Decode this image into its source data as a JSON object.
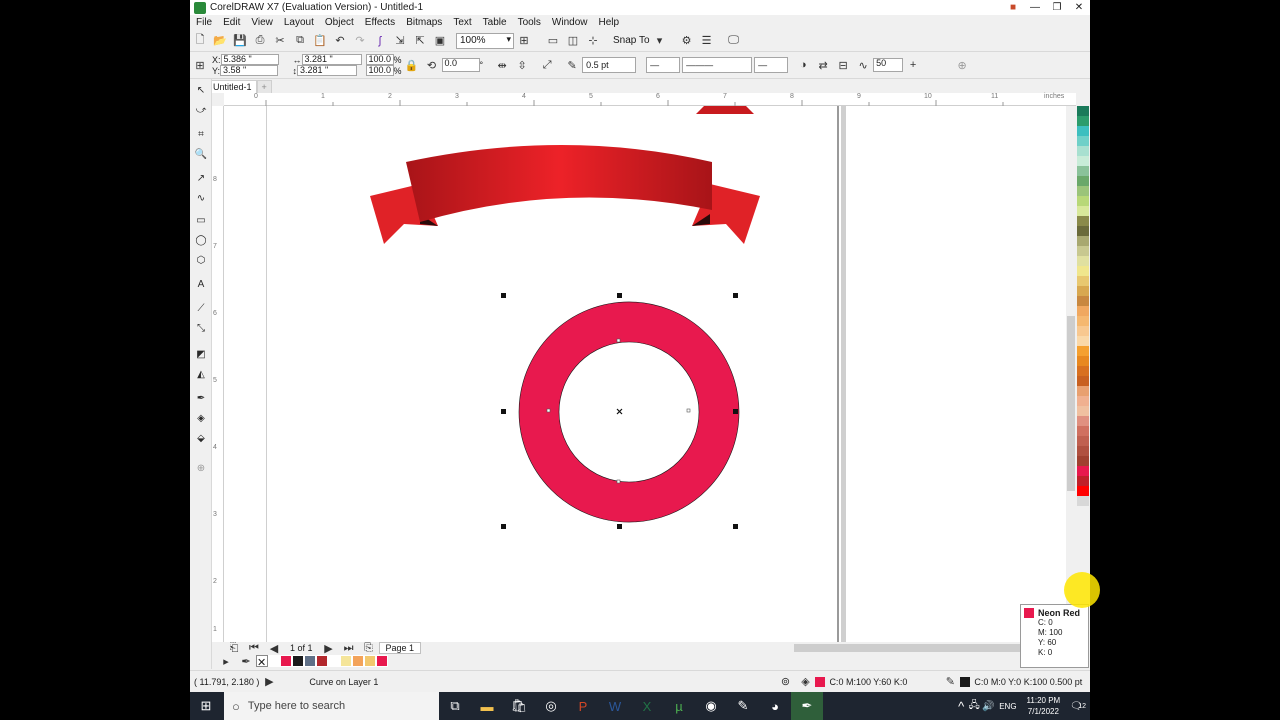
{
  "window": {
    "title": "CorelDRAW X7 (Evaluation Version) - Untitled-1"
  },
  "menu": [
    "File",
    "Edit",
    "View",
    "Layout",
    "Object",
    "Effects",
    "Bitmaps",
    "Text",
    "Table",
    "Tools",
    "Window",
    "Help"
  ],
  "toolbar": {
    "zoom": "100%",
    "snap_to": "Snap To"
  },
  "props": {
    "x_label": "X:",
    "x_value": "5.386 \"",
    "y_label": "Y:",
    "y_value": "3.58 \"",
    "w_value": "3.281 \"",
    "h_value": "3.281 \"",
    "scale_w": "100.0",
    "scale_h": "100.0",
    "pct": "%",
    "angle": "0.0",
    "deg": "°",
    "outline_width": "0.5 pt",
    "smooth": "50"
  },
  "doc_tab": "Untitled-1",
  "ruler": {
    "unit": "inches",
    "h_ticks": [
      "0",
      "1",
      "2",
      "3",
      "4",
      "5",
      "6",
      "7",
      "8",
      "9",
      "10",
      "11"
    ],
    "v_ticks": [
      "8",
      "7",
      "6",
      "5",
      "4",
      "3",
      "2",
      "1"
    ]
  },
  "pages": {
    "count": "1 of 1",
    "tab": "Page 1"
  },
  "status": {
    "cursor_pos": "( 11.791, 2.180 )",
    "object_info": "Curve on Layer 1",
    "fill_info": "C:0 M:100 Y:60 K:0",
    "outline_info": "C:0 M:0 Y:0 K:100  0.500 pt"
  },
  "tooltip": {
    "name": "Neon Red",
    "c": "C: 0",
    "m": "M: 100",
    "y": "Y: 60",
    "k": "K: 0"
  },
  "colors": {
    "ring": "#e8194e",
    "ribbon_light": "#e8222a",
    "ribbon_dark": "#a81418",
    "accent": "#2a8a3a"
  },
  "doc_palette": [
    "#ffffff",
    "#e8194e",
    "#1a1a1a",
    "#5f6f86",
    "#b3282d",
    "#ffffff",
    "#f5e59a",
    "#f3a35a",
    "#f2c86e",
    "#e8194e"
  ],
  "color_palette": [
    "#1a7a5a",
    "#2c9c6c",
    "#3dbfbf",
    "#6fd0c8",
    "#a8e0d0",
    "#c8ecd8",
    "#8ac29a",
    "#6aa86a",
    "#9bc47a",
    "#b8d878",
    "#d8e89a",
    "#8a8a4a",
    "#6a6a3a",
    "#a8a870",
    "#c8c890",
    "#e0e0a0",
    "#f0e68c",
    "#e8c870",
    "#d8a850",
    "#c88840",
    "#f0a860",
    "#f5b870",
    "#f8c890",
    "#fad8a8",
    "#f5a030",
    "#e88820",
    "#d87020",
    "#c86020",
    "#e8a070",
    "#f0b090",
    "#f0c0a0",
    "#e09080",
    "#d07060",
    "#c06050",
    "#b05040",
    "#a04030",
    "#e8194e",
    "#c0202a",
    "#ff0000",
    "#d8d8d8"
  ],
  "taskbar": {
    "search_placeholder": "Type here to search",
    "lang": "ENG",
    "time": "11:20 PM",
    "date": "7/1/2022",
    "notifications": "12"
  }
}
